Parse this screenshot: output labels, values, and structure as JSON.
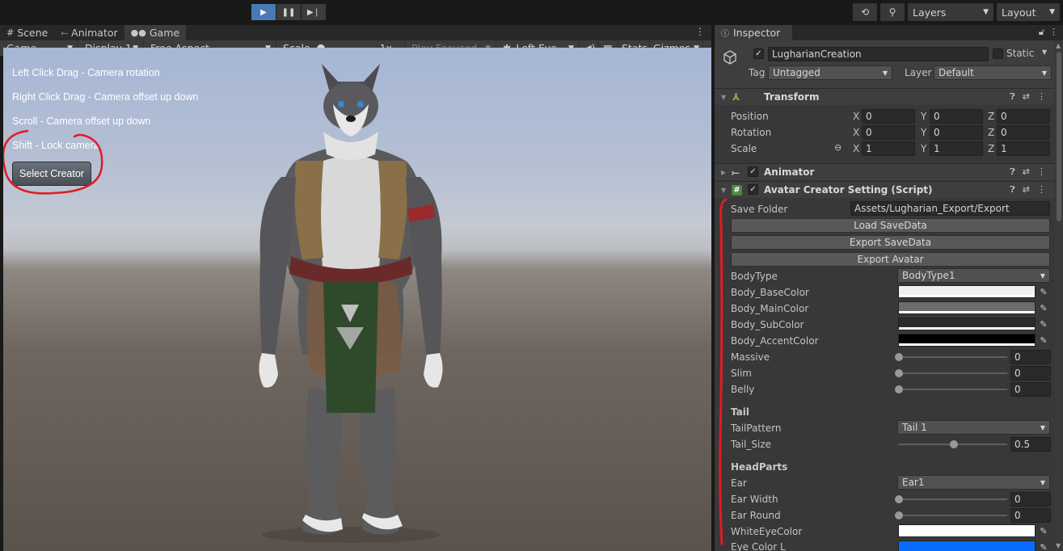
{
  "toolbar": {
    "play_icon": "play-icon",
    "pause_icon": "pause-icon",
    "step_icon": "step-icon",
    "history_icon": "history-icon",
    "search_icon": "search-icon",
    "layers_label": "Layers",
    "layout_label": "Layout",
    "accent": "#4a7ab6"
  },
  "game_panel": {
    "tabs": [
      {
        "label": "Scene",
        "icon": "grid-icon"
      },
      {
        "label": "Animator",
        "icon": "animator-icon"
      },
      {
        "label": "Game",
        "icon": "gamepad-icon"
      }
    ],
    "view_mode": "Game",
    "display": "Display 1",
    "aspect": "Free Aspect",
    "scale_label": "Scale",
    "scale_value": "1x",
    "play_focused": "Play Focused",
    "eye": "Left Eye",
    "stats": "Stats",
    "gizmos": "Gizmos"
  },
  "viewport": {
    "help_lines": [
      "Left Click Drag - Camera rotation",
      "Right Click Drag - Camera offset up down",
      "Scroll - Camera offset up down",
      "Shift - Lock camera"
    ],
    "select_creator": "Select Creator",
    "annotation_color": "#e01b24"
  },
  "inspector": {
    "tab_label": "Inspector",
    "object_name": "LugharianCreation",
    "static_label": "Static",
    "tag_label": "Tag",
    "tag_value": "Untagged",
    "layer_label": "Layer",
    "layer_value": "Default",
    "transform": {
      "title": "Transform",
      "rows": [
        {
          "label": "Position",
          "x": "0",
          "y": "0",
          "z": "0"
        },
        {
          "label": "Rotation",
          "x": "0",
          "y": "0",
          "z": "0"
        },
        {
          "label": "Scale",
          "x": "1",
          "y": "1",
          "z": "1"
        }
      ]
    },
    "animator_title": "Animator",
    "script": {
      "title": "Avatar Creator Setting (Script)",
      "save_folder_label": "Save Folder",
      "save_folder_value": "Assets/Lugharian_Export/Export",
      "buttons": [
        "Load SaveData",
        "Export SaveData",
        "Export Avatar"
      ],
      "body_type_label": "BodyType",
      "body_type_value": "BodyType1",
      "colors": [
        {
          "label": "Body_BaseColor",
          "color": "#f0f0f0"
        },
        {
          "label": "Body_MainColor",
          "color": "#6c6c6c"
        },
        {
          "label": "Body_SubColor",
          "color": "#2b2b2b"
        },
        {
          "label": "Body_AccentColor",
          "color": "#000000"
        }
      ],
      "sliders": [
        {
          "label": "Massive",
          "value": "0",
          "fraction": 0
        },
        {
          "label": "Slim",
          "value": "0",
          "fraction": 0
        },
        {
          "label": "Belly",
          "value": "0",
          "fraction": 0
        }
      ],
      "tail_section": "Tail",
      "tail_pattern_label": "TailPattern",
      "tail_pattern_value": "Tail 1",
      "tail_size_label": "Tail_Size",
      "tail_size_value": "0.5",
      "tail_size_fraction": 0.5,
      "head_section": "HeadParts",
      "ear_label": "Ear",
      "ear_value": "Ear1",
      "ear_width_label": "Ear Width",
      "ear_width_value": "0",
      "ear_round_label": "Ear Round",
      "ear_round_value": "0",
      "white_eye_label": "WhiteEyeColor",
      "white_eye_color": "#ffffff",
      "eye_l_label": "Eye Color L",
      "eye_l_color": "#0a6cff"
    }
  }
}
